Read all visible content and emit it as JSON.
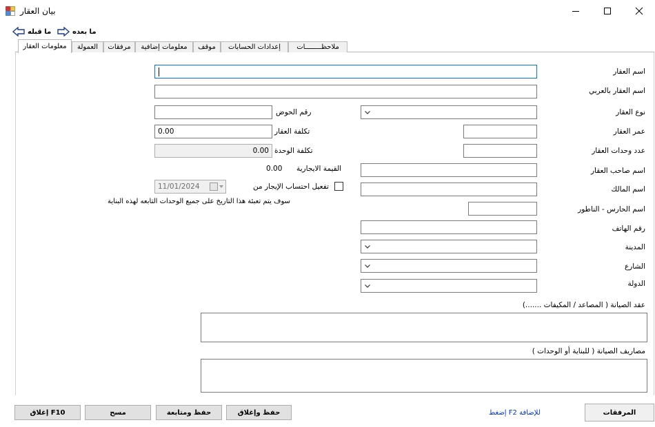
{
  "window": {
    "title": "بيان العقار",
    "icons": {
      "app": "property-app-icon",
      "minimize": "minimize-icon",
      "maximize": "maximize-icon",
      "close": "close-icon"
    }
  },
  "toolbar": {
    "next_label": "ما بعده",
    "prev_label": "ما قبله"
  },
  "tabs": [
    {
      "label": "معلومات العقار",
      "active": true
    },
    {
      "label": "العمولة"
    },
    {
      "label": "مرفقات"
    },
    {
      "label": "معلومات إضافية"
    },
    {
      "label": "موقف"
    },
    {
      "label": "إعدادات الحسابات"
    },
    {
      "label": "ملاحظــــــــات"
    }
  ],
  "form": {
    "property_name": {
      "label": "اسم العقار",
      "value": ""
    },
    "property_name_ar": {
      "label": "اسم العقار بالعربي",
      "value": ""
    },
    "property_type": {
      "label": "نوع العقار",
      "value": ""
    },
    "basin_number": {
      "label": "رقم الحوض",
      "value": ""
    },
    "property_age": {
      "label": "عمر العقار",
      "value": ""
    },
    "property_cost": {
      "label": "تكلفة العقار",
      "value": "0.00"
    },
    "unit_count": {
      "label": "عدد وحدات العقار",
      "value": ""
    },
    "unit_cost": {
      "label": "تكلفة الوحدة",
      "value": "0.00"
    },
    "owner_name": {
      "label": "اسم صاحب العقار",
      "value": ""
    },
    "rental_value": {
      "label": "القيمة الايجارية",
      "value": "0.00"
    },
    "landlord": {
      "label": "اسم المالك",
      "value": ""
    },
    "rent_calc": {
      "label": "تفعيل احتساب الإيجار من",
      "date": "11/01/2024",
      "checked": false
    },
    "rent_note": "سوف يتم تعبئة هذا التاريخ على جميع الوحدات التابعه لهذه البناية",
    "guard_name": {
      "label": "اسم الحارس - الناطور",
      "value": ""
    },
    "phone": {
      "label": "رقم الهاتف",
      "value": ""
    },
    "city": {
      "label": "المدينة",
      "value": ""
    },
    "street": {
      "label": "الشارع",
      "value": ""
    },
    "country": {
      "label": "الدولة",
      "value": ""
    },
    "maintenance_contract": {
      "label": "عقد الصيانة ( المصاعد / المكيفات .......)",
      "value": ""
    },
    "maintenance_expenses": {
      "label": "مصاريف الصيانة ( للبناية أو الوحدات )",
      "value": ""
    }
  },
  "footer": {
    "attachments": "المرفقات",
    "hint": "إضغط F2 للإضافة",
    "save_close": "حفظ وإغلاق",
    "save_continue": "حفظ ومتابعة",
    "clear": "مسح",
    "close": "إغلاق F10"
  }
}
